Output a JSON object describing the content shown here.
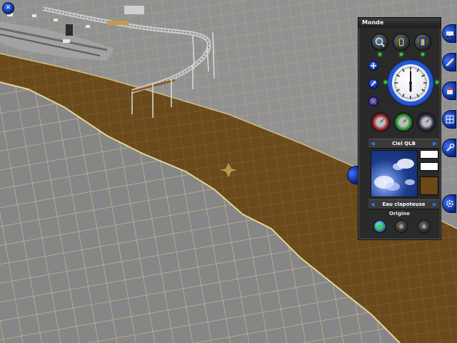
{
  "window": {
    "title": "Monde"
  },
  "icons": {
    "corner": "close-x-icon",
    "tools": [
      "magnifier-icon",
      "yellow-door-icon",
      "blue-door-icon"
    ],
    "small": [
      "plus-icon",
      "pin-icon",
      "delete-icon"
    ],
    "weather": [
      "red-weather-dial-icon",
      "green-weather-dial-icon",
      "dark-weather-dial-icon"
    ],
    "side": [
      "train-icon",
      "track-icon",
      "build-icon",
      "grid-icon",
      "wrench-icon",
      "gear-icon"
    ]
  },
  "clock": {
    "hour": 6,
    "minute": 0
  },
  "sky": {
    "label": "Ciel QLB"
  },
  "water": {
    "label": "Eau clapoteuse"
  },
  "swatches": {
    "colors": [
      "#ffffff",
      "#ffffff",
      "#6b4818"
    ]
  },
  "origin": {
    "label": "Origine",
    "active_index": 0
  },
  "colors": {
    "accent": "#2b62e4",
    "terrain": "#8d8d8d",
    "water": "#6b4818",
    "grid": "#e9d58c"
  }
}
